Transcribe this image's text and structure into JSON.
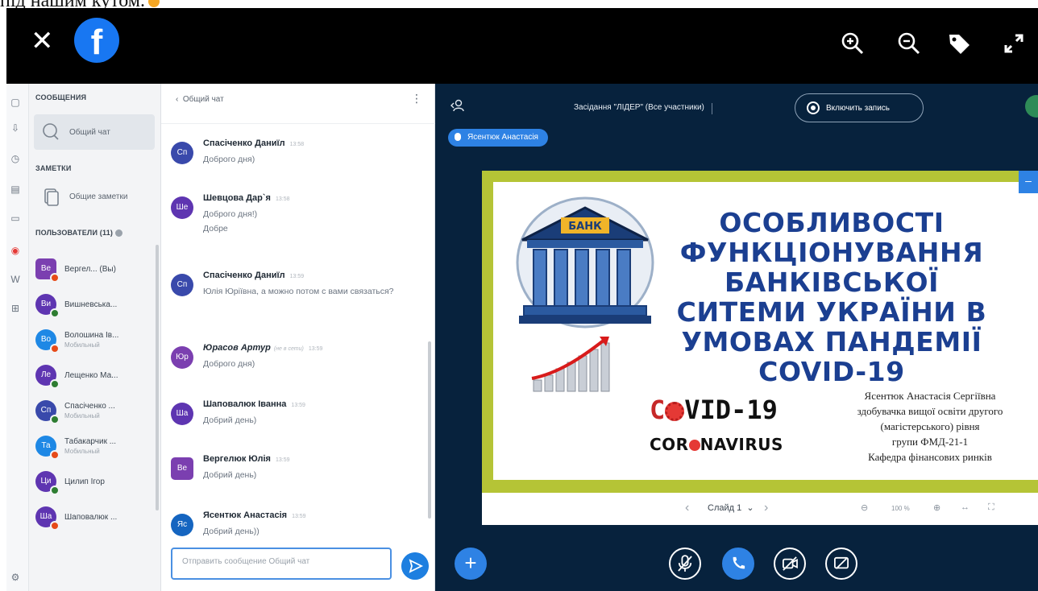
{
  "top_cut_text": "під нашим кутом.",
  "facebook": {
    "tools": [
      "zoom-in",
      "zoom-out",
      "tag",
      "expand"
    ]
  },
  "sidebar": {
    "messages_title": "СООБЩЕНИЯ",
    "public_chat": "Общий чат",
    "notes_title": "ЗАМЕТКИ",
    "shared_notes": "Общие заметки",
    "users_title": "ПОЛЬЗОВАТЕЛИ (11)",
    "users": [
      {
        "initials": "Ве",
        "name": "Вергел... (Вы)",
        "sub": "",
        "color": "#7b3fb0"
      },
      {
        "initials": "Ви",
        "name": "Вишневська...",
        "sub": "",
        "color": "#5e35b1"
      },
      {
        "initials": "Во",
        "name": "Волошина Ів...",
        "sub": "Мобильный",
        "color": "#1e88e5"
      },
      {
        "initials": "Ле",
        "name": "Лещенко Ма...",
        "sub": "",
        "color": "#5e35b1"
      },
      {
        "initials": "Сп",
        "name": "Спасіченко ...",
        "sub": "Мобильный",
        "color": "#3949ab"
      },
      {
        "initials": "Та",
        "name": "Табакарчик ...",
        "sub": "Мобильный",
        "color": "#1e88e5"
      },
      {
        "initials": "Ци",
        "name": "Цилип Ігор",
        "sub": "",
        "color": "#5e35b1"
      },
      {
        "initials": "Ша",
        "name": "Шаповалюк ...",
        "sub": "",
        "color": "#5e35b1"
      }
    ]
  },
  "chat": {
    "back_label": "Общий чат",
    "input_placeholder": "Отправить сообщение Общий чат",
    "messages": [
      {
        "initials": "Сп",
        "name": "Спасіченко Даниїл",
        "note": "",
        "time": "13:58",
        "lines": [
          "Доброго дня)"
        ],
        "color": "#3949ab"
      },
      {
        "initials": "Ше",
        "name": "Шевцова Дар`я",
        "note": "",
        "time": "13:58",
        "lines": [
          "Доброго дня!)",
          "Добре"
        ],
        "color": "#5e35b1"
      },
      {
        "initials": "Сп",
        "name": "Спасіченко Даниїл",
        "note": "",
        "time": "13:59",
        "lines": [
          "Юлія Юріївна, а можно потом с вами связаться?"
        ],
        "color": "#3949ab"
      },
      {
        "initials": "Юр",
        "name": "Юрасов Артур",
        "note": "(не в сети)",
        "time": "13:59",
        "lines": [
          "Доброго дня)"
        ],
        "color": "#7b3fb0"
      },
      {
        "initials": "Ша",
        "name": "Шаповалюк Іванна",
        "note": "",
        "time": "13:59",
        "lines": [
          "Добрий день)"
        ],
        "color": "#5e35b1"
      },
      {
        "initials": "Ве",
        "name": "Вергелюк Юлія",
        "note": "",
        "time": "13:59",
        "lines": [
          "Добрий день)"
        ],
        "color": "#7b3fb0"
      },
      {
        "initials": "Яс",
        "name": "Ясентюк Анастасія",
        "note": "",
        "time": "13:59",
        "lines": [
          "Добрий день))"
        ],
        "color": "#1565c0"
      }
    ]
  },
  "presentation": {
    "meeting_title": "Засідання \"ЛІДЕР\" (Все участники)",
    "record_label": "Включить запись",
    "speaking": "Ясентюк Анастасія",
    "slide": {
      "bank_label": "БАНК",
      "title_lines": [
        "ОСОБЛИВОСТІ",
        "ФУНКЦІОНУВАННЯ",
        "БАНКІВСЬКОЇ",
        "СИТЕМИ УКРАЇНИ В",
        "УМОВАХ ПАНДЕМІЇ",
        "COVID-19"
      ],
      "covid_text": "C VID-19",
      "coronavirus_text": "COR NAVIRUS",
      "author_lines": [
        "Ясентюк Анастасія Сергіївна",
        "здобувачка вищої освіти другого",
        "(магістерського) рівня",
        "групи ФМД-21-1",
        "Кафедра фінансових ринків"
      ]
    },
    "slide_nav": "Слайд 1",
    "zoom": "100 %"
  },
  "colors": {
    "accent": "#2e82e4",
    "dark_bg": "#07223d",
    "slide_border": "#b5c436",
    "title_blue": "#1b3f91"
  }
}
